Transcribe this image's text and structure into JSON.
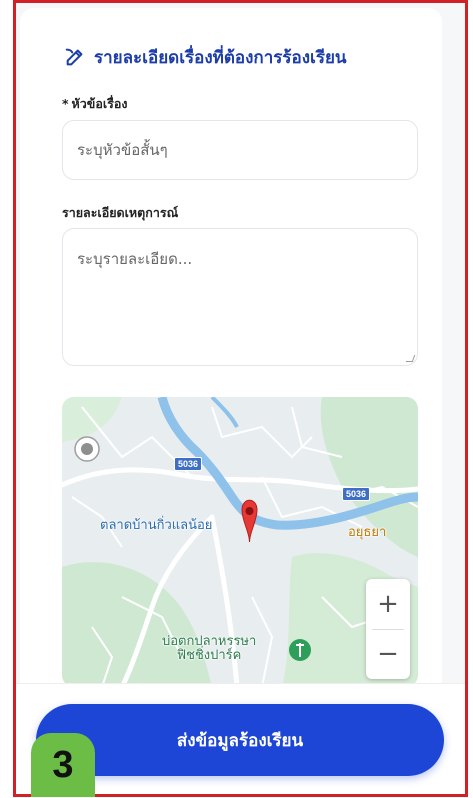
{
  "section": {
    "title": "รายละเอียดเรื่องที่ต้องการร้องเรียน",
    "icon": "edit-pen-icon"
  },
  "subject": {
    "required_mark": "*",
    "label": "หัวข้อเรื่อง",
    "placeholder": "ระบุหัวข้อสั้นๆ"
  },
  "details": {
    "label": "รายละเอียดเหตุการณ์",
    "placeholder": "ระบุรายละเอียด..."
  },
  "map": {
    "places": {
      "market": "ตลาดบ้านกิ่วแลน้อย",
      "fishing_park": "บ่อตกปลาหรรษา\nฟิชชิ่งปาร์ค",
      "ayutthaya": "อยุธยา"
    },
    "road_numbers": [
      "5036",
      "5036"
    ],
    "zoom_in": "+",
    "zoom_out": "−",
    "colors": {
      "water": "#7fb8e6",
      "green": "#c8e6c9",
      "pin": "#e53935"
    }
  },
  "submit_button": {
    "label": "ส่งข้อมูลร้องเรียน"
  },
  "step_badge": {
    "label": "3"
  },
  "colors": {
    "accent": "#1d45d6",
    "title": "#1d3da8",
    "frame": "#d31f26",
    "badge": "#6bbd45"
  }
}
